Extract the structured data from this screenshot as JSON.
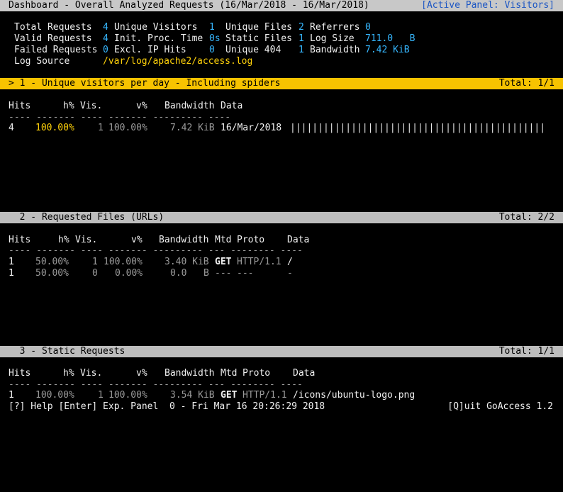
{
  "top_bar": {
    "title": "Dashboard - Overall Analyzed Requests (16/Mar/2018 - 16/Mar/2018)",
    "active_panel": "[Active Panel: Visitors]"
  },
  "summary": {
    "total_requests_label": "Total Requests",
    "total_requests_value": "4",
    "unique_visitors_label": "Unique Visitors",
    "unique_visitors_value": "1",
    "unique_files_label": "Unique Files",
    "unique_files_value": "2",
    "referrers_label": "Referrers",
    "referrers_value": "0",
    "valid_requests_label": "Valid Requests",
    "valid_requests_value": "4",
    "init_proc_time_label": "Init. Proc. Time",
    "init_proc_time_value": "0s",
    "static_files_label": "Static Files",
    "static_files_value": "1",
    "log_size_label": "Log Size",
    "log_size_value": "711.0   B",
    "failed_requests_label": "Failed Requests",
    "failed_requests_value": "0",
    "excl_ip_hits_label": "Excl. IP Hits",
    "excl_ip_hits_value": "0",
    "unique_404_label": "Unique 404",
    "unique_404_value": "1",
    "bandwidth_label": "Bandwidth",
    "bandwidth_value": "7.42 KiB",
    "log_source_label": "Log Source",
    "log_source_value": "/var/log/apache2/access.log"
  },
  "panel1": {
    "title": "> 1 - Unique visitors per day - Including spiders",
    "total": "Total: 1/1",
    "columns": [
      "Hits",
      "h%",
      "Vis.",
      "v%",
      "Bandwidth",
      "Data"
    ],
    "separator": "---- ------- ---- ------- --------- ----",
    "rows": [
      {
        "hits": "4",
        "hp": "100.00%",
        "vis": "1",
        "vp": "100.00%",
        "bw": "7.42 KiB",
        "data": "16/Mar/2018",
        "bar": "||||||||||||||||||||||||||||||||||||||||||||||"
      }
    ]
  },
  "panel2": {
    "title": "  2 - Requested Files (URLs)",
    "total": "Total: 2/2",
    "columns": [
      "Hits",
      "h%",
      "Vis.",
      "v%",
      "Bandwidth",
      "Mtd",
      "Proto",
      "Data"
    ],
    "separator": "---- ------- ---- ------- --------- --- -------- ----",
    "rows": [
      {
        "hits": "1",
        "hp": "50.00%",
        "vis": "1",
        "vp": "100.00%",
        "bw": "3.40 KiB",
        "mtd": "GET",
        "proto": "HTTP/1.1",
        "data": "/"
      },
      {
        "hits": "1",
        "hp": "50.00%",
        "vis": "0",
        "vp": "0.00%",
        "bw": "0.0   B",
        "mtd": "---",
        "proto": "---",
        "data": "-"
      }
    ]
  },
  "panel3": {
    "title": "  3 - Static Requests",
    "total": "Total: 1/1",
    "columns": [
      "Hits",
      "h%",
      "Vis.",
      "v%",
      "Bandwidth",
      "Mtd",
      "Proto",
      "Data"
    ],
    "separator": "---- ------- ---- ------- --------- --- -------- ----",
    "rows": [
      {
        "hits": "1",
        "hp": "100.00%",
        "vis": "1",
        "vp": "100.00%",
        "bw": "3.54 KiB",
        "mtd": "GET",
        "proto": "HTTP/1.1",
        "data": "/icons/ubuntu-logo.png"
      }
    ]
  },
  "footer": {
    "help": "[?] Help [Enter] Exp. Panel  0 - Fri Mar 16 20:26:29 2018",
    "quit": "[Q]uit GoAccess 1.2"
  }
}
